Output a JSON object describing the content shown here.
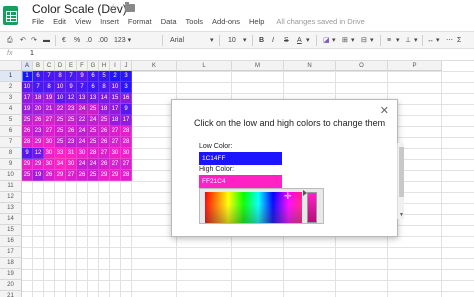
{
  "header": {
    "title": "Color Scale (Dev)",
    "star_icon": "star-icon",
    "folder_icon": "folder-icon",
    "menu": [
      "File",
      "Edit",
      "View",
      "Insert",
      "Format",
      "Data",
      "Tools",
      "Add-ons",
      "Help"
    ],
    "saved_status": "All changes saved in Drive"
  },
  "toolbar": {
    "currency": "€",
    "percent": "%",
    "decimal_dec": ".0",
    "decimal_inc": ".00",
    "number_format": "123 ▾",
    "font": "Arial",
    "font_size": "10",
    "bold": "B",
    "italic": "I",
    "strike": "S",
    "text_color": "A"
  },
  "formula_bar": {
    "fx": "fx",
    "value": "1"
  },
  "grid": {
    "columns": [
      "A",
      "B",
      "C",
      "D",
      "E",
      "F",
      "G",
      "H",
      "I",
      "J",
      "K",
      "L",
      "M",
      "N",
      "O",
      "P"
    ],
    "rows": [
      "1",
      "2",
      "3",
      "4",
      "5",
      "6",
      "7",
      "8",
      "9",
      "10",
      "11",
      "12",
      "13",
      "14",
      "15",
      "16",
      "17",
      "18",
      "19",
      "20",
      "21"
    ],
    "low_color": "#1C14FF",
    "high_color": "#FF21C4",
    "max_value": 32,
    "cells": [
      [
        "1",
        "6",
        "7",
        "8",
        "7",
        "9",
        "6",
        "5",
        "2",
        "3"
      ],
      [
        "10",
        "7",
        "8",
        "10",
        "9",
        "7",
        "6",
        "8",
        "10",
        "3"
      ],
      [
        "17",
        "18",
        "19",
        "10",
        "12",
        "13",
        "13",
        "14",
        "15",
        "16"
      ],
      [
        "19",
        "20",
        "21",
        "22",
        "23",
        "24",
        "25",
        "18",
        "17",
        "9"
      ],
      [
        "25",
        "26",
        "27",
        "25",
        "25",
        "22",
        "24",
        "25",
        "18",
        "17"
      ],
      [
        "26",
        "23",
        "27",
        "25",
        "26",
        "24",
        "25",
        "26",
        "27",
        "28"
      ],
      [
        "28",
        "29",
        "30",
        "25",
        "23",
        "24",
        "25",
        "26",
        "27",
        "28"
      ],
      [
        "9",
        "12",
        "30",
        "33",
        "31",
        "30",
        "28",
        "27",
        "30",
        "30"
      ],
      [
        "29",
        "29",
        "30",
        "34",
        "30",
        "24",
        "24",
        "26",
        "27",
        "27"
      ],
      [
        "25",
        "19",
        "26",
        "29",
        "27",
        "26",
        "25",
        "29",
        "29",
        "28"
      ]
    ]
  },
  "dialog": {
    "title": "Click on the low and high colors to change them",
    "close_icon": "close-icon",
    "low_label": "Low Color:",
    "low_value": "1C14FF",
    "high_label": "High Color:",
    "high_value": "FF21C4"
  }
}
